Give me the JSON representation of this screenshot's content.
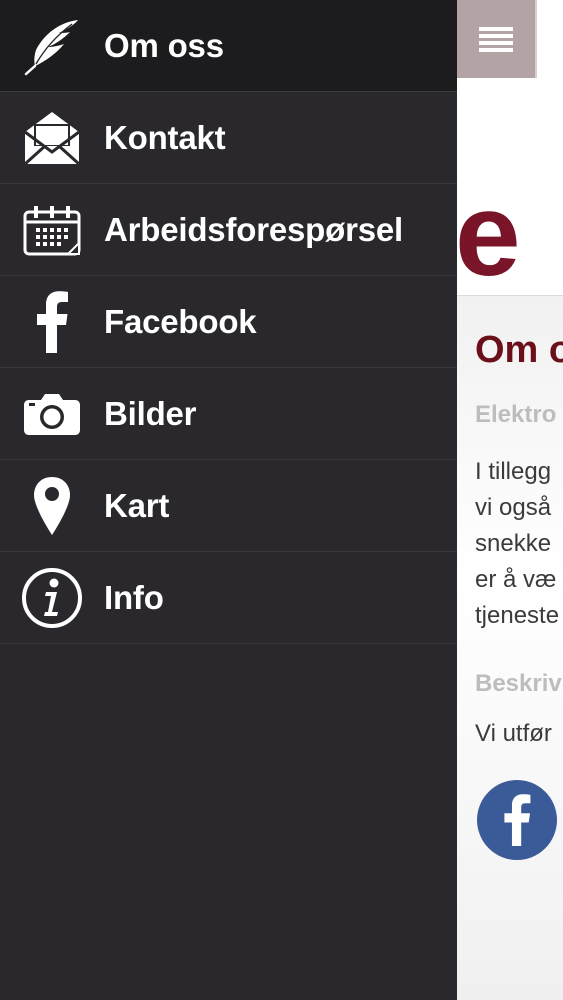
{
  "menu": {
    "items": [
      {
        "label": "Om oss",
        "icon": "feather-icon",
        "active": true
      },
      {
        "label": "Kontakt",
        "icon": "envelope-icon"
      },
      {
        "label": "Arbeidsforespørsel",
        "icon": "calendar-icon"
      },
      {
        "label": "Facebook",
        "icon": "facebook-icon"
      },
      {
        "label": "Bilder",
        "icon": "camera-icon"
      },
      {
        "label": "Kart",
        "icon": "map-pin-icon"
      },
      {
        "label": "Info",
        "icon": "info-icon"
      }
    ]
  },
  "page": {
    "logo_letter": "e",
    "title": "Om o",
    "subheading_1": "Elektro",
    "paragraph_lines": [
      "I tillegg",
      "vi også",
      "snekke",
      "er å væ",
      "tjeneste"
    ],
    "subheading_2": "Beskriv",
    "paragraph_2": "Vi utfør"
  },
  "colors": {
    "drawer_bg": "#2a282c",
    "active_bg": "#1c1b1e",
    "accent": "#7a1428",
    "hamburger_bg": "#b4a3a4",
    "facebook_blue": "#3a5a98"
  }
}
